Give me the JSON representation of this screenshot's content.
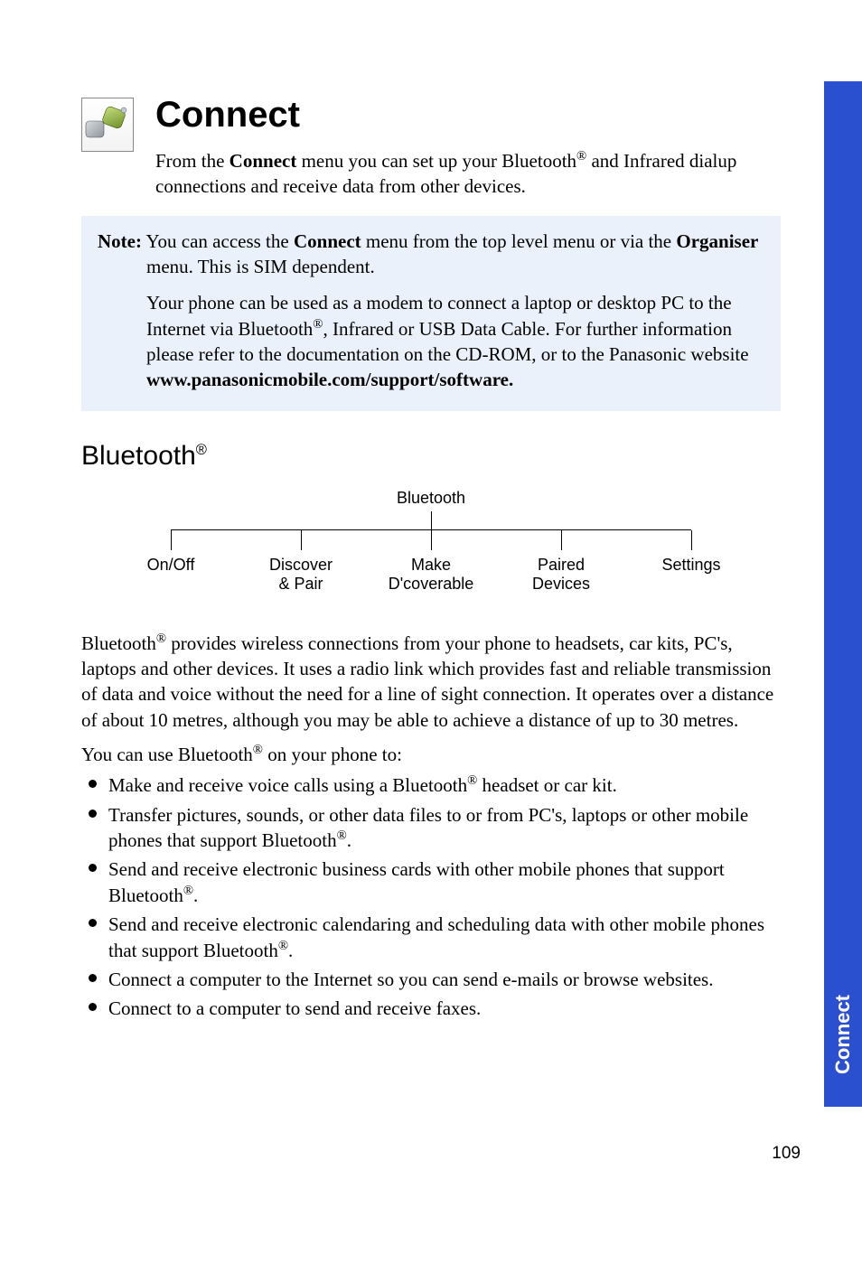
{
  "title": "Connect",
  "intro_pre": "From the ",
  "intro_bold": "Connect",
  "intro_mid": " menu you can set up your Bluetooth",
  "intro_post": " and Infrared dialup connections and receive data from other devices.",
  "note": {
    "label": "Note:",
    "p1_a": "You can access the ",
    "p1_b": "Connect",
    "p1_c": " menu from the top level menu or via the ",
    "p1_d": "Organiser",
    "p1_e": " menu. This is SIM dependent.",
    "p2_a": "Your phone can be used as a modem to connect a laptop or desktop PC to the Internet via Bluetooth",
    "p2_b": ", Infrared or USB Data Cable. For further information please refer to the documentation on the CD-ROM, or to the Panasonic website ",
    "p2_url": "www.panasonicmobile.com/support/software."
  },
  "section_heading": "Bluetooth",
  "tree": {
    "root": "Bluetooth",
    "items": [
      {
        "l1": "On/Off",
        "l2": ""
      },
      {
        "l1": "Discover",
        "l2": "& Pair"
      },
      {
        "l1": "Make",
        "l2": "D'coverable"
      },
      {
        "l1": "Paired",
        "l2": "Devices"
      },
      {
        "l1": "Settings",
        "l2": ""
      }
    ]
  },
  "para1_a": "Bluetooth",
  "para1_b": " provides wireless connections from your phone to headsets, car kits, PC's, laptops and other devices. It uses a radio link which provides fast and reliable transmission of data and voice without the need for a line of sight connection. It operates over a distance of about 10 metres, although you may be able to achieve a distance of up to 30 metres.",
  "para2_a": "You can use Bluetooth",
  "para2_b": " on your phone to:",
  "bullets": {
    "b1_a": "Make and receive voice calls using a Bluetooth",
    "b1_b": " headset or car kit.",
    "b2_a": "Transfer pictures, sounds, or other data files to or from PC's, laptops or other mobile phones that support Bluetooth",
    "b2_b": ".",
    "b3_a": "Send and receive electronic business cards with other mobile phones that support Bluetooth",
    "b3_b": ".",
    "b4_a": "Send and receive electronic calendaring and scheduling data with other mobile phones that support Bluetooth",
    "b4_b": ".",
    "b5": "Connect a computer to the Internet so you can send e-mails or browse websites.",
    "b6": "Connect to a computer to send and receive faxes."
  },
  "reg": "®",
  "sidetab": "Connect",
  "pagenum": "109"
}
